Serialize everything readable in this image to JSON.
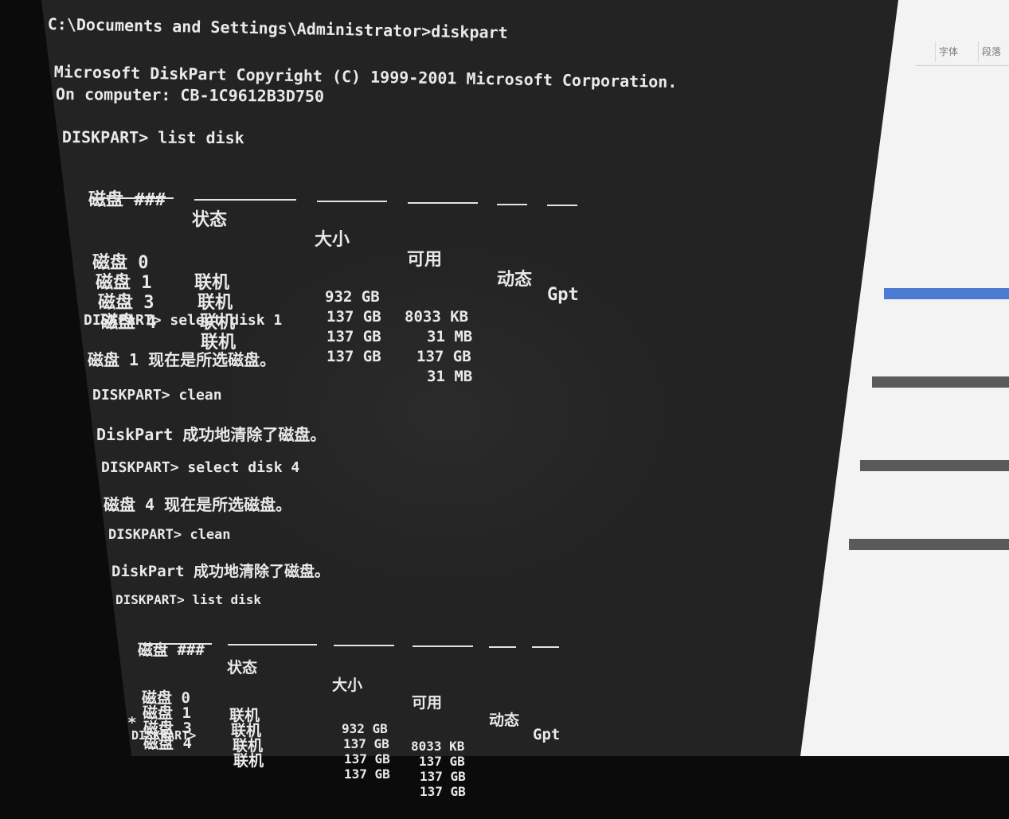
{
  "terminal": {
    "prompt_cmd": "C:\\Documents and Settings\\Administrator>diskpart",
    "banner_line1": "Microsoft DiskPart Copyright (C) 1999-2001 Microsoft Corporation.",
    "banner_line2": "On computer: CB-1C9612B3D750",
    "cmd_list1": "DISKPART> list disk",
    "cmd_select1": "DISKPART> select disk 1",
    "msg_select1": "磁盘 1 现在是所选磁盘。",
    "cmd_clean1": "DISKPART> clean",
    "msg_clean1": "DiskPart 成功地清除了磁盘。",
    "cmd_select4": "DISKPART> select disk 4",
    "msg_select4": "磁盘 4 现在是所选磁盘。",
    "cmd_clean2": "DISKPART> clean",
    "msg_clean2": "DiskPart 成功地清除了磁盘。",
    "cmd_list2": "DISKPART> list disk",
    "final_prompt": "DISKPART>"
  },
  "table_headers": {
    "disk": "磁盘 ###",
    "status": "状态",
    "size": "大小",
    "free": "可用",
    "dyn": "动态",
    "gpt": "Gpt"
  },
  "table1": {
    "rows": [
      {
        "marker": " ",
        "disk": "磁盘 0",
        "status": "联机",
        "size": "932 GB",
        "free": "8033 KB"
      },
      {
        "marker": " ",
        "disk": "磁盘 1",
        "status": "联机",
        "size": "137 GB",
        "free": "31 MB"
      },
      {
        "marker": " ",
        "disk": "磁盘 3",
        "status": "联机",
        "size": "137 GB",
        "free": "137 GB"
      },
      {
        "marker": " ",
        "disk": "磁盘 4",
        "status": "联机",
        "size": "137 GB",
        "free": "31 MB"
      }
    ]
  },
  "table2": {
    "rows": [
      {
        "marker": " ",
        "disk": "磁盘 0",
        "status": "联机",
        "size": "932 GB",
        "free": "8033 KB"
      },
      {
        "marker": " ",
        "disk": "磁盘 1",
        "status": "联机",
        "size": "137 GB",
        "free": "137 GB"
      },
      {
        "marker": " ",
        "disk": "磁盘 3",
        "status": "联机",
        "size": "137 GB",
        "free": "137 GB"
      },
      {
        "marker": "*",
        "disk": "磁盘 4",
        "status": "联机",
        "size": "137 GB",
        "free": "137 GB"
      }
    ]
  },
  "sidebar": {
    "cell1": "字体",
    "cell2": "段落"
  },
  "colors": {
    "console_bg": "#232324",
    "console_text": "#e9e9e9",
    "selection_blue": "#4d7bd3"
  }
}
